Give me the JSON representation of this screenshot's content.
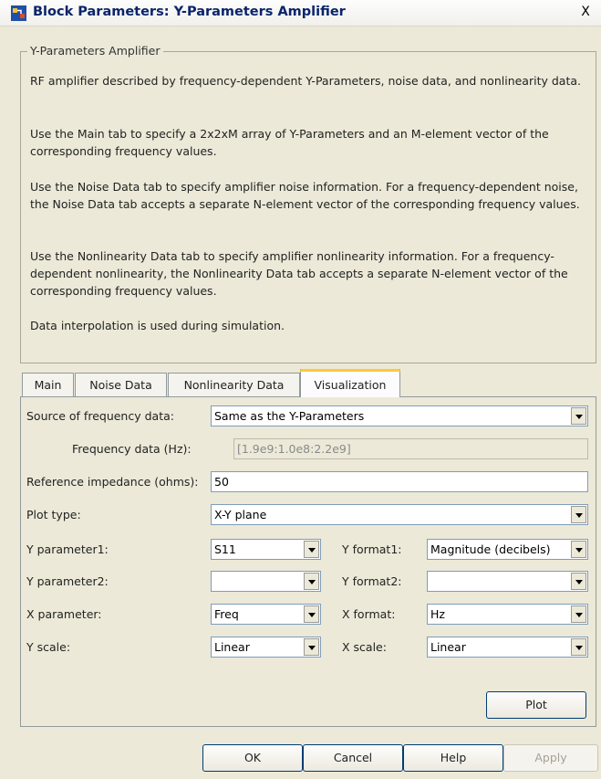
{
  "window": {
    "title": "Block Parameters: Y-Parameters Amplifier",
    "close_glyph": "X"
  },
  "description": {
    "group_title": "Y-Parameters Amplifier",
    "paragraphs": [
      "RF amplifier described by frequency-dependent Y-Parameters, noise data, and nonlinearity data.",
      "Use the Main tab to specify a 2x2xM array of Y-Parameters and an M-element vector of the corresponding frequency values.",
      "Use the Noise Data tab to specify amplifier noise information. For a frequency-dependent noise, the Noise Data tab accepts a separate N-element vector of the corresponding frequency values.",
      "Use the Nonlinearity Data tab to specify amplifier nonlinearity information. For a frequency-dependent nonlinearity, the Nonlinearity Data tab accepts a separate N-element vector of the corresponding frequency values.",
      "Data interpolation is used during simulation."
    ]
  },
  "tabs": [
    {
      "label": "Main"
    },
    {
      "label": "Noise Data"
    },
    {
      "label": "Nonlinearity Data"
    },
    {
      "label": "Visualization"
    }
  ],
  "selected_tab": "Visualization",
  "form": {
    "source_freq": {
      "label": "Source of frequency data:",
      "value": "Same as the Y-Parameters"
    },
    "freq_data": {
      "label": "Frequency data (Hz):",
      "value": "[1.9e9:1.0e8:2.2e9]"
    },
    "ref_impedance": {
      "label": "Reference impedance (ohms):",
      "value": "50"
    },
    "plot_type": {
      "label": "Plot type:",
      "value": "X-Y plane"
    },
    "y_param1": {
      "label": "Y parameter1:",
      "value": "S11"
    },
    "y_format1": {
      "label": "Y format1:",
      "value": "Magnitude (decibels)"
    },
    "y_param2": {
      "label": "Y parameter2:",
      "value": ""
    },
    "y_format2": {
      "label": "Y format2:",
      "value": ""
    },
    "x_param": {
      "label": "X parameter:",
      "value": "Freq"
    },
    "x_format": {
      "label": "X format:",
      "value": "Hz"
    },
    "y_scale": {
      "label": "Y scale:",
      "value": "Linear"
    },
    "x_scale": {
      "label": "X scale:",
      "value": "Linear"
    }
  },
  "buttons": {
    "plot": "Plot",
    "ok": "OK",
    "cancel": "Cancel",
    "help": "Help",
    "apply": "Apply"
  },
  "colors": {
    "window_bg": "#ece9d8",
    "title_text": "#0a246a",
    "selected_tab_accent": "#ffc83c"
  },
  "icons": {
    "app": "simulink-block-icon",
    "close": "close-icon",
    "dropdown": "chevron-down-icon"
  }
}
